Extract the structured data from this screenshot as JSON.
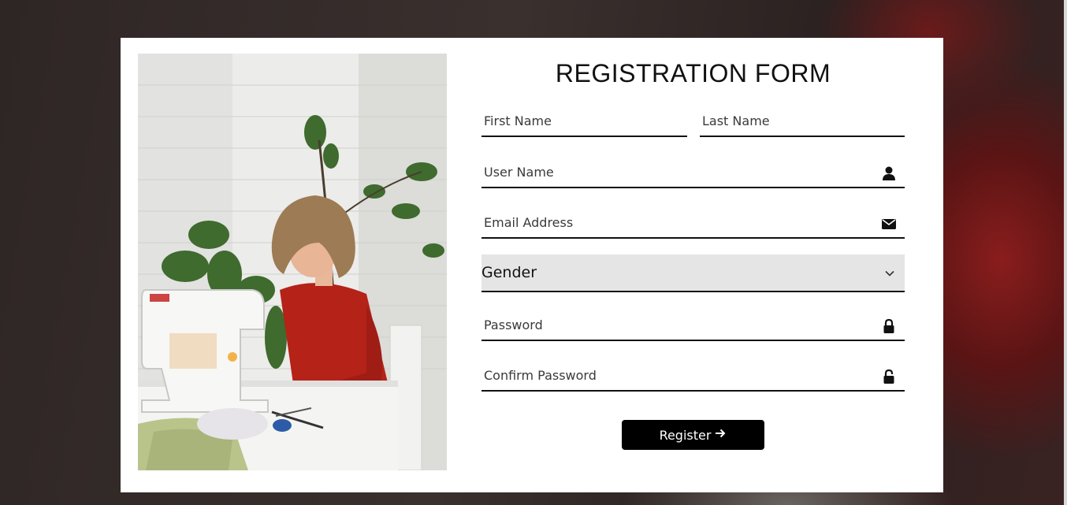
{
  "form": {
    "title": "REGISTRATION FORM",
    "first_name_placeholder": "First Name",
    "last_name_placeholder": "Last Name",
    "username_placeholder": "User Name",
    "email_placeholder": "Email Address",
    "gender_selected": "Gender",
    "password_placeholder": "Password",
    "confirm_password_placeholder": "Confirm Password",
    "register_label": "Register"
  },
  "icons": {
    "username": "user-icon",
    "email": "envelope-icon",
    "gender": "chevron-down-icon",
    "password": "lock-closed-icon",
    "confirm_password": "lock-open-icon",
    "register": "arrow-right-icon"
  },
  "colors": {
    "card": "#ffffff",
    "button": "#000000",
    "select_bg": "#e5e5e5"
  }
}
